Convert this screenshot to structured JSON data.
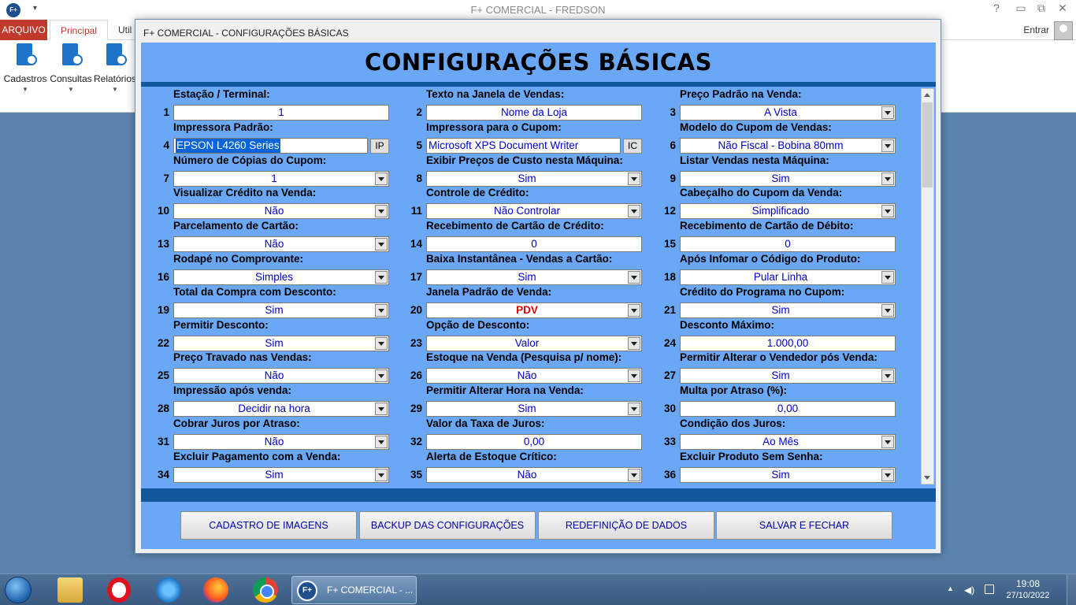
{
  "app": {
    "icon_text": "F+",
    "title": "F+ COMERCIAL - FREDSON",
    "help": "?",
    "restore": "⧉",
    "close": "✕",
    "tabs": [
      "ARQUIVO",
      "Principal",
      "Util"
    ],
    "entrar": "Entrar",
    "ribbon_buttons": [
      "Cadastros",
      "Consultas",
      "Relatórios"
    ]
  },
  "dialog": {
    "title": "F+ COMERCIAL - CONFIGURAÇÕES BÁSICAS",
    "heading": "CONFIGURAÇÕES BÁSICAS",
    "fields": [
      {
        "num": "1",
        "label": "Estação / Terminal:",
        "value": "1",
        "type": "text"
      },
      {
        "num": "2",
        "label": "Texto na Janela de Vendas:",
        "value": "Nome da Loja",
        "type": "text"
      },
      {
        "num": "3",
        "label": "Preço Padrão na Venda:",
        "value": "A Vista",
        "type": "combo"
      },
      {
        "num": "4",
        "label": "Impressora Padrão:",
        "value": "EPSON L4260 Series",
        "type": "text-button",
        "button": "IP",
        "selected": true
      },
      {
        "num": "5",
        "label": "Impressora para o Cupom:",
        "value": "Microsoft XPS Document Writer",
        "type": "text-button",
        "button": "IC"
      },
      {
        "num": "6",
        "label": "Modelo do Cupom de Vendas:",
        "value": "Não Fiscal - Bobina 80mm",
        "type": "combo"
      },
      {
        "num": "7",
        "label": "Número de Cópias do Cupom:",
        "value": "1",
        "type": "combo"
      },
      {
        "num": "8",
        "label": "Exibir Preços de Custo nesta Máquina:",
        "value": "Sim",
        "type": "combo"
      },
      {
        "num": "9",
        "label": "Listar Vendas nesta Máquina:",
        "value": "Sim",
        "type": "combo"
      },
      {
        "num": "10",
        "label": "Visualizar Crédito na Venda:",
        "value": "Não",
        "type": "combo"
      },
      {
        "num": "11",
        "label": "Controle de Crédito:",
        "value": "Não Controlar",
        "type": "combo"
      },
      {
        "num": "12",
        "label": "Cabeçalho do Cupom da Venda:",
        "value": "Simplificado",
        "type": "combo"
      },
      {
        "num": "13",
        "label": "Parcelamento de Cartão:",
        "value": "Não",
        "type": "combo"
      },
      {
        "num": "14",
        "label": "Recebimento de Cartão de Crédito:",
        "value": "0",
        "type": "text"
      },
      {
        "num": "15",
        "label": "Recebimento de Cartão de Débito:",
        "value": "0",
        "type": "text"
      },
      {
        "num": "16",
        "label": "Rodapé no Comprovante:",
        "value": "Simples",
        "type": "combo"
      },
      {
        "num": "17",
        "label": "Baixa Instantânea - Vendas a Cartão:",
        "value": "Sim",
        "type": "combo"
      },
      {
        "num": "18",
        "label": "Após Infomar o Código do Produto:",
        "value": "Pular Linha",
        "type": "combo"
      },
      {
        "num": "19",
        "label": "Total da Compra com Desconto:",
        "value": "Sim",
        "type": "combo"
      },
      {
        "num": "20",
        "label": "Janela Padrão de Venda:",
        "value": "PDV",
        "type": "combo",
        "red": true
      },
      {
        "num": "21",
        "label": "Crédito do Programa no Cupom:",
        "value": "Sim",
        "type": "combo"
      },
      {
        "num": "22",
        "label": "Permitir Desconto:",
        "value": "Sim",
        "type": "combo"
      },
      {
        "num": "23",
        "label": "Opção de Desconto:",
        "value": "Valor",
        "type": "combo"
      },
      {
        "num": "24",
        "label": "Desconto Máximo:",
        "value": "1.000,00",
        "type": "text"
      },
      {
        "num": "25",
        "label": "Preço Travado nas Vendas:",
        "value": "Não",
        "type": "combo"
      },
      {
        "num": "26",
        "label": "Estoque na Venda (Pesquisa p/ nome):",
        "value": "Não",
        "type": "combo"
      },
      {
        "num": "27",
        "label": "Permitir Alterar o Vendedor pós Venda:",
        "value": "Sim",
        "type": "combo"
      },
      {
        "num": "28",
        "label": "Impressão após venda:",
        "value": "Decidir na hora",
        "type": "combo"
      },
      {
        "num": "29",
        "label": "Permitir Alterar Hora na Venda:",
        "value": "Sim",
        "type": "combo"
      },
      {
        "num": "30",
        "label": "Multa por Atraso (%):",
        "value": "0,00",
        "type": "text"
      },
      {
        "num": "31",
        "label": "Cobrar Juros por Atraso:",
        "value": "Não",
        "type": "combo"
      },
      {
        "num": "32",
        "label": "Valor da Taxa de Juros:",
        "value": "0,00",
        "type": "text"
      },
      {
        "num": "33",
        "label": "Condição dos Juros:",
        "value": "Ao Mês",
        "type": "combo"
      },
      {
        "num": "34",
        "label": "Excluir Pagamento com a Venda:",
        "value": "Sim",
        "type": "combo"
      },
      {
        "num": "35",
        "label": "Alerta de Estoque Crítico:",
        "value": "Não",
        "type": "combo"
      },
      {
        "num": "36",
        "label": "Excluir Produto Sem Senha:",
        "value": "Sim",
        "type": "combo"
      }
    ],
    "buttons": [
      {
        "name": "cadastro-imagens-button",
        "label": "CADASTRO DE IMAGENS"
      },
      {
        "name": "backup-configuracoes-button",
        "label": "BACKUP DAS CONFIGURAÇÕES"
      },
      {
        "name": "redefinicao-dados-button",
        "label": "REDEFINIÇÃO DE DADOS"
      },
      {
        "name": "salvar-fechar-button",
        "label": "SALVAR E FECHAR"
      }
    ]
  },
  "taskbar": {
    "app_label": "F+ COMERCIAL - ...",
    "app_logo": "F+",
    "time": "19:08",
    "date": "27/10/2022"
  },
  "colors": {
    "dialog_bg": "#6aa8f5",
    "band": "#11579b",
    "value_text": "#0000cd",
    "accent_red": "#e00000"
  }
}
